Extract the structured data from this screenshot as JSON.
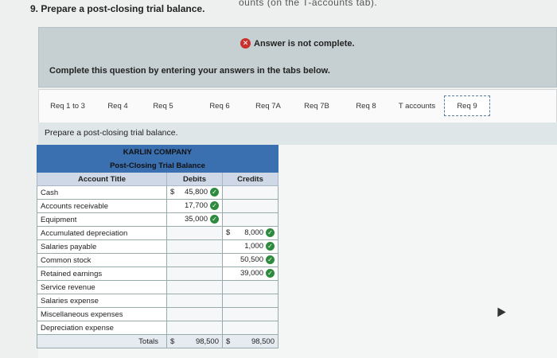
{
  "question": {
    "title": "9. Prepare a post-closing trial balance.",
    "title_cut_text": "ounts (on the T-accounts tab)."
  },
  "status": {
    "message": "Answer is not complete.",
    "instruction": "Complete this question by entering your answers in the tabs below."
  },
  "tabs": [
    {
      "label": "Req 1 to 3",
      "active": false
    },
    {
      "label": "Req 4",
      "active": false
    },
    {
      "label": "Req 5",
      "active": false
    },
    {
      "label": "Req 6",
      "active": false
    },
    {
      "label": "Req 7A",
      "active": false
    },
    {
      "label": "Req 7B",
      "active": false
    },
    {
      "label": "Req 8",
      "active": false
    },
    {
      "label": "T accounts",
      "active": false
    },
    {
      "label": "Req 9",
      "active": true
    }
  ],
  "sub_label": "Prepare a post-closing trial balance.",
  "trial_balance": {
    "company": "KARLIN COMPANY",
    "title": "Post-Closing Trial Balance",
    "headers": {
      "account": "Account Title",
      "debits": "Debits",
      "credits": "Credits"
    },
    "rows": [
      {
        "account": "Cash",
        "debit": "45,800",
        "debit_dollar": true,
        "credit": "",
        "credit_dollar": false
      },
      {
        "account": "Accounts receivable",
        "debit": "17,700",
        "debit_dollar": false,
        "credit": "",
        "credit_dollar": false
      },
      {
        "account": "Equipment",
        "debit": "35,000",
        "debit_dollar": false,
        "credit": "",
        "credit_dollar": false
      },
      {
        "account": "Accumulated depreciation",
        "debit": "",
        "debit_dollar": false,
        "credit": "8,000",
        "credit_dollar": true
      },
      {
        "account": "Salaries payable",
        "debit": "",
        "debit_dollar": false,
        "credit": "1,000",
        "credit_dollar": false
      },
      {
        "account": "Common stock",
        "debit": "",
        "debit_dollar": false,
        "credit": "50,500",
        "credit_dollar": false
      },
      {
        "account": "Retained earnings",
        "debit": "",
        "debit_dollar": false,
        "credit": "39,000",
        "credit_dollar": false
      },
      {
        "account": "Service revenue",
        "debit": "",
        "debit_dollar": false,
        "credit": "",
        "credit_dollar": false
      },
      {
        "account": "Salaries expense",
        "debit": "",
        "debit_dollar": false,
        "credit": "",
        "credit_dollar": false
      },
      {
        "account": "Miscellaneous expenses",
        "debit": "",
        "debit_dollar": false,
        "credit": "",
        "credit_dollar": false
      },
      {
        "account": "Depreciation expense",
        "debit": "",
        "debit_dollar": false,
        "credit": "",
        "credit_dollar": false
      }
    ],
    "totals": {
      "label": "Totals",
      "debit": "98,500",
      "credit": "98,500",
      "dollar": "$"
    },
    "dollar_sign": "$"
  },
  "colors": {
    "header_blue": "#3a6fb0",
    "check_green": "#2e8b3e",
    "error_red": "#c9302c"
  }
}
